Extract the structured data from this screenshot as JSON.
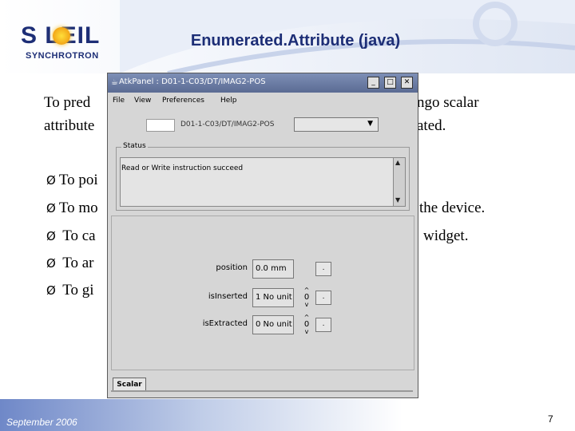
{
  "slide": {
    "logo_word": "S LEIL",
    "logo_sub": "SYNCHROTRON",
    "title": "Enumerated.Attribute (java)",
    "lines": [
      {
        "arrow": "",
        "text": "To pred"
      },
      {
        "arrow": "",
        "text": "attribute"
      },
      {
        "arrow": "Ø",
        "text": "To poi"
      },
      {
        "arrow": "Ø",
        "text": "To mo"
      },
      {
        "arrow": "Ø",
        "text": " To ca"
      },
      {
        "arrow": "Ø",
        "text": " To ar"
      },
      {
        "arrow": "Ø",
        "text": " To gi"
      }
    ],
    "right_fragments": [
      {
        "text": "ngo scalar"
      },
      {
        "text": "ated."
      },
      {
        "text": "the device."
      },
      {
        "text": "widget."
      }
    ],
    "footer_date": "September 2006",
    "page_number": "7"
  },
  "window": {
    "title": "AtkPanel : D01-1-C03/DT/IMAG2-POS",
    "buttons": {
      "minimize": "_",
      "maximize": "□",
      "close": "✕"
    },
    "menu": [
      "File",
      "View",
      "Preferences",
      "Help"
    ],
    "device_label": "D01-1-C03/DT/IMAG2-POS",
    "status_title": "Status",
    "status_text": "Read or Write instruction succeed",
    "properties": [
      {
        "label": "position",
        "value": "0.0 mm",
        "button": "."
      },
      {
        "label": "isInserted",
        "value": "1 No unit",
        "spinner": "0",
        "button": "."
      },
      {
        "label": "isExtracted",
        "value": "0 No unit",
        "spinner": "0",
        "button": "."
      }
    ],
    "tab": "Scalar"
  }
}
